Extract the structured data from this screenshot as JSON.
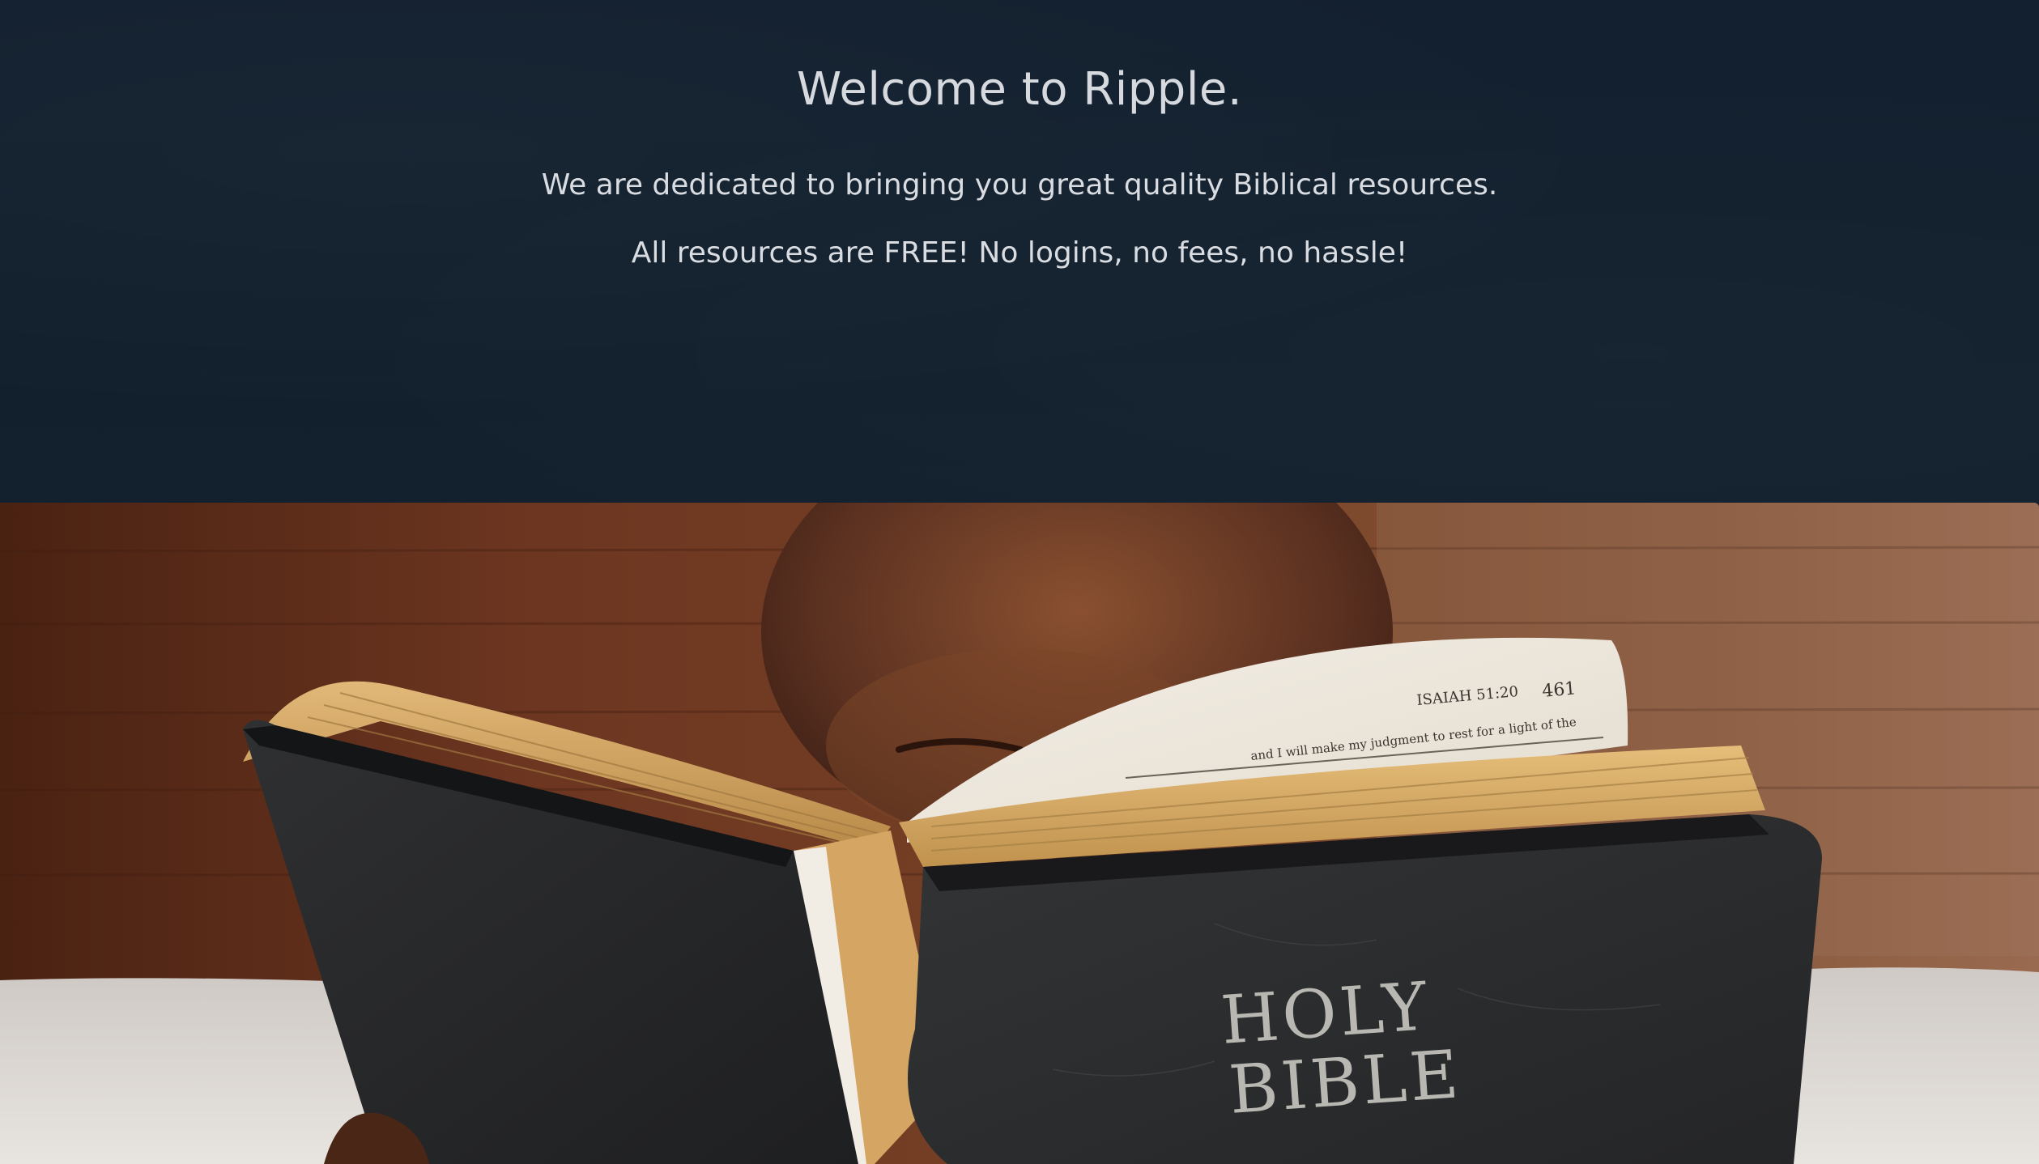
{
  "hero": {
    "title": "Welcome to Ripple.",
    "line1": "We are dedicated to bringing you great quality Biblical resources.",
    "line2": "All resources are FREE! No logins, no fees, no hassle!"
  },
  "photo": {
    "description_icon": "holy-bible-photo",
    "cover_text_line1": "HOLY",
    "cover_text_line2": "BIBLE",
    "page_header": "ISAIAH 51:20",
    "page_number": "461",
    "page_text": "and I will make my judgment to rest for a light of the"
  },
  "colors": {
    "hero_bg": "#12202e",
    "hero_text": "#d9dde2"
  }
}
